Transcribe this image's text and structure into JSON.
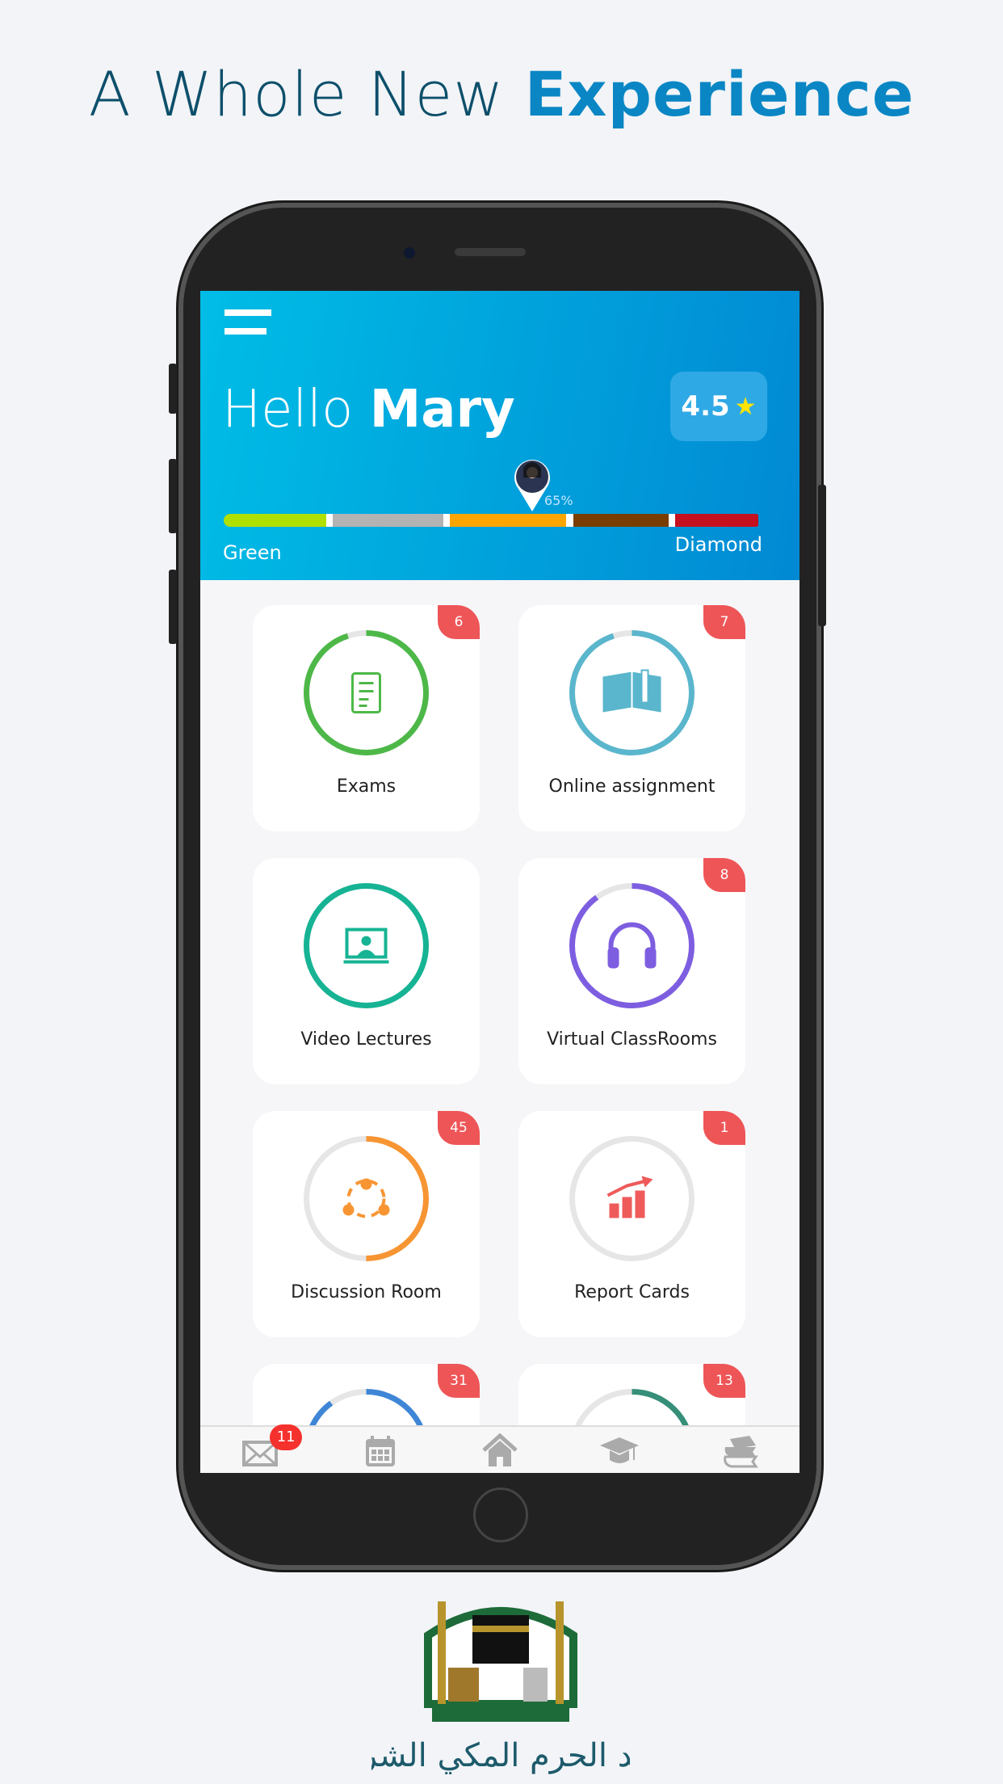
{
  "headline": {
    "regular": "A Whole New",
    "bold": "Experience"
  },
  "header": {
    "greeting": "Hello",
    "name": "Mary",
    "rating": "4.5",
    "progress_percent": "65%",
    "progress_value": 65,
    "level_start": "Green",
    "level_end": "Diamond",
    "segments": [
      {
        "color": "#b0e000",
        "share": 19
      },
      {
        "color": "#b3b3b3",
        "share": 20.5
      },
      {
        "color": "#ffa500",
        "share": 21.6
      },
      {
        "color": "#7a3d00",
        "share": 17.7
      },
      {
        "color": "#c4101f",
        "share": 15.4
      }
    ]
  },
  "cards": [
    {
      "label": "Exams",
      "badge": "6",
      "color": "#4db848",
      "progress": 0.95,
      "icon": "exam-checklist-icon"
    },
    {
      "label": "Online assignment",
      "badge": "7",
      "color": "#5ab6cc",
      "progress": 0.95,
      "icon": "book-pencil-icon"
    },
    {
      "label": "Video Lectures",
      "badge": "",
      "color": "#16b394",
      "progress": 1,
      "icon": "video-lecture-icon"
    },
    {
      "label": "Virtual ClassRooms",
      "badge": "8",
      "color": "#7d5ee0",
      "progress": 0.9,
      "icon": "headphones-icon"
    },
    {
      "label": "Discussion Room",
      "badge": "45",
      "color": "#f79533",
      "progress": 0.5,
      "icon": "group-discussion-icon"
    },
    {
      "label": "Report Cards",
      "badge": "1",
      "color": "#ef5a5a",
      "progress": 0,
      "icon": "growth-chart-icon"
    },
    {
      "label": "",
      "badge": "31",
      "color": "#3f86d6",
      "progress": 0.9,
      "icon": ""
    },
    {
      "label": "",
      "badge": "13",
      "color": "#368f78",
      "progress": 0.6,
      "icon": ""
    }
  ],
  "bottom_nav": [
    {
      "icon": "mail-icon",
      "badge": "11"
    },
    {
      "icon": "calendar-icon"
    },
    {
      "icon": "home-icon"
    },
    {
      "icon": "graduation-cap-icon"
    },
    {
      "icon": "books-icon"
    }
  ],
  "logo_text": "معهد الحرم المكي الشريف"
}
